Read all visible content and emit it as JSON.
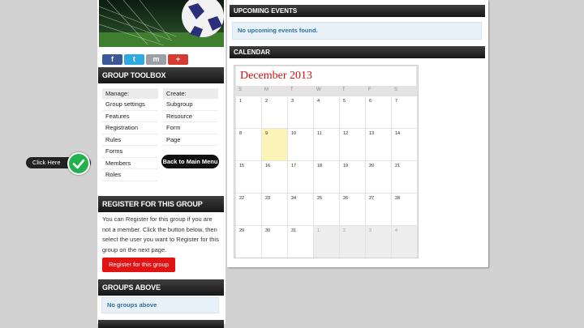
{
  "social": {
    "facebook": "f",
    "twitter": "t",
    "myspace": "m",
    "google": "+"
  },
  "toolbox": {
    "title": "GROUP TOOLBOX",
    "manage_head": "Manage:",
    "manage_items": [
      "Group settings",
      "Features",
      "Registration",
      "Rules",
      "Forms",
      "Members",
      "Roles"
    ],
    "create_head": "Create:",
    "create_items": [
      "Subgroup",
      "Resource",
      "Form",
      "Page"
    ],
    "back_label": "Back to Main Menu"
  },
  "register": {
    "title": "REGISTER FOR THIS GROUP",
    "text": "You can Register for this group if you are not a member. Click the button below, then select the user you want to Register for this group on the next page.",
    "button_label": "Register for this group"
  },
  "groups_above": {
    "title": "GROUPS ABOVE",
    "message": "No groups above"
  },
  "upcoming": {
    "title": "UPCOMING EVENTS",
    "message": "No upcoming events found."
  },
  "calendar": {
    "title": "CALENDAR",
    "month": "December 2013",
    "weekdays": [
      "S",
      "M",
      "T",
      "W",
      "T",
      "F",
      "S"
    ],
    "weeks": [
      [
        "1",
        "2",
        "3",
        "4",
        "5",
        "6",
        "7"
      ],
      [
        "8",
        "9",
        "10",
        "11",
        "12",
        "13",
        "14"
      ],
      [
        "15",
        "16",
        "17",
        "18",
        "19",
        "20",
        "21"
      ],
      [
        "22",
        "23",
        "24",
        "25",
        "26",
        "27",
        "28"
      ],
      [
        "29",
        "30",
        "31",
        "1",
        "2",
        "3",
        "4"
      ]
    ],
    "highlight_day": "9",
    "accent": "#cc1111"
  },
  "callout": {
    "label": "Click Here",
    "color": "#22b14c"
  }
}
